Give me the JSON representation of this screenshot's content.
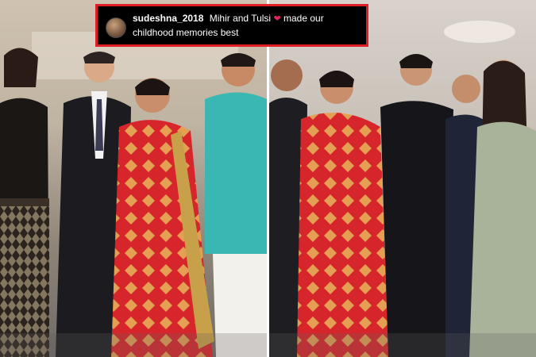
{
  "comment": {
    "username": "sudeshna_2018",
    "text_before_heart": "Mihir and Tulsi",
    "heart": "❤",
    "text_after_heart": "made our childhood memories best"
  },
  "colors": {
    "highlight_border": "#e01e26",
    "heart": "#e0245e",
    "saree_red": "#d7262b",
    "saree_gold": "#e8b45a",
    "kurta_teal": "#3bb7b3"
  },
  "icons": [
    "avatar",
    "heart-icon"
  ]
}
